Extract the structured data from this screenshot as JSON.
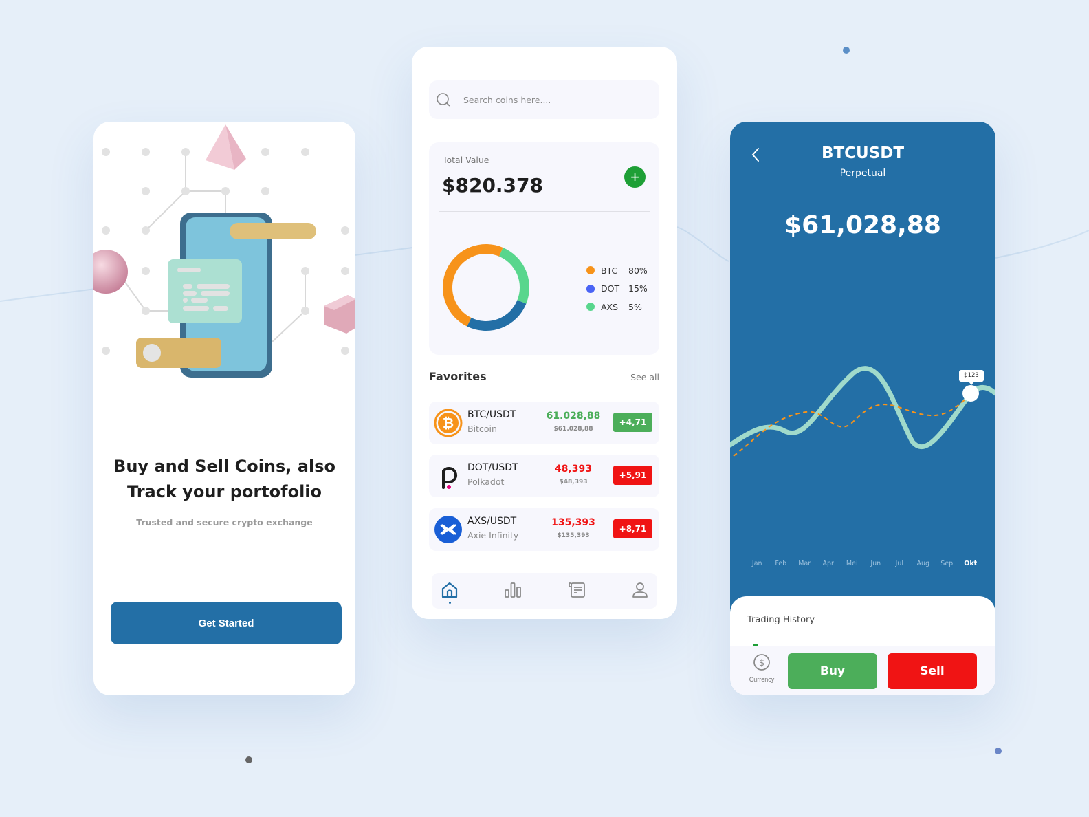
{
  "colors": {
    "primary": "#236fa6",
    "positive": "#4cae5a",
    "negative": "#f01414",
    "btc": "#f7931a",
    "dot": "#4a64f5",
    "axs": "#58d68d",
    "chart_line": "#a0dacb",
    "chart_dashed": "#f7931a"
  },
  "onboarding": {
    "headline_line1": "Buy and Sell Coins, also",
    "headline_line2": "Track your portofolio",
    "subtitle": "Trusted and secure crypto exchange",
    "cta_label": "Get Started"
  },
  "portfolio": {
    "search_placeholder": "Search coins here....",
    "total_label": "Total Value",
    "total_value": "$820.378",
    "add_label": "+",
    "allocation": [
      {
        "symbol": "BTC",
        "percent_label": "80%",
        "share": 80,
        "color": "#f7931a"
      },
      {
        "symbol": "DOT",
        "percent_label": "15%",
        "share": 15,
        "color": "#4a64f5"
      },
      {
        "symbol": "AXS",
        "percent_label": "5%",
        "share": 5,
        "color": "#58d68d"
      }
    ],
    "favorites_title": "Favorites",
    "see_all_label": "See all",
    "favorites": [
      {
        "pair": "BTC/USDT",
        "name": "Bitcoin",
        "price": "61.028,88",
        "usd": "$61.028,88",
        "change": "+4,71",
        "trend": "up"
      },
      {
        "pair": "DOT/USDT",
        "name": "Polkadot",
        "price": "48,393",
        "usd": "$48,393",
        "change": "+5,91",
        "trend": "down"
      },
      {
        "pair": "AXS/USDT",
        "name": "Axie Infinity",
        "price": "135,393",
        "usd": "$135,393",
        "change": "+8,71",
        "trend": "down"
      }
    ],
    "nav": [
      {
        "icon": "home-icon",
        "active": true
      },
      {
        "icon": "chart-bar-icon",
        "active": false
      },
      {
        "icon": "news-icon",
        "active": false
      },
      {
        "icon": "user-icon",
        "active": false
      }
    ]
  },
  "detail": {
    "title": "BTCUSDT",
    "subtitle": "Perpetual",
    "price": "$61,028,88",
    "tooltip": "$123",
    "months": [
      "Jan",
      "Feb",
      "Mar",
      "Apr",
      "Mei",
      "Jun",
      "Jul",
      "Aug",
      "Sep",
      "Okt"
    ],
    "active_month": "Okt",
    "trading_history_label": "Trading History",
    "currency_label": "Currency",
    "buy_label": "Buy",
    "sell_label": "Sell"
  }
}
